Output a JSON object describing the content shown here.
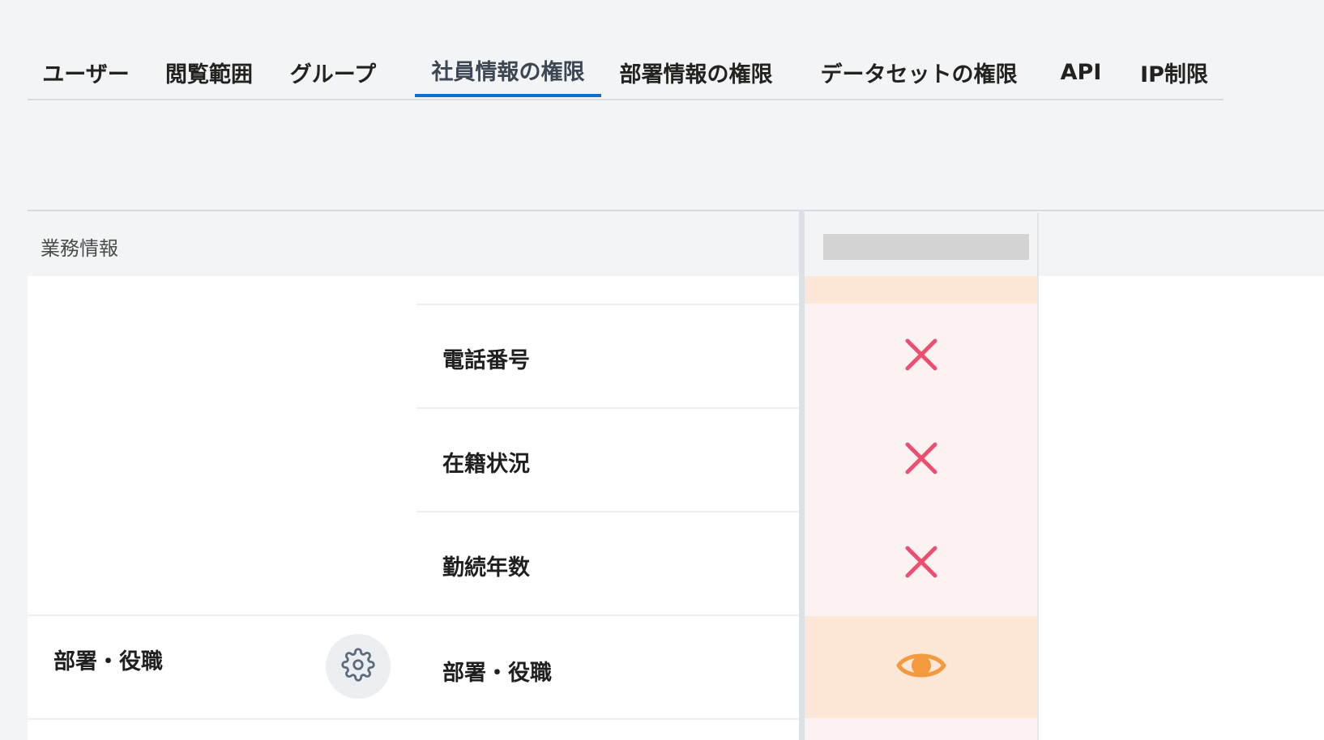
{
  "tabs": [
    {
      "label": "ユーザー",
      "active": false
    },
    {
      "label": "閲覧範囲",
      "active": false
    },
    {
      "label": "グループ",
      "active": false
    },
    {
      "label": "社員情報の権限",
      "active": true
    },
    {
      "label": "部署情報の権限",
      "active": false
    },
    {
      "label": "データセットの権限",
      "active": false
    },
    {
      "label": "API",
      "active": false
    },
    {
      "label": "IP制限",
      "active": false
    }
  ],
  "section": {
    "title": "業務情報"
  },
  "rows": [
    {
      "label": "電話番号",
      "permission": "none"
    },
    {
      "label": "在籍状況",
      "permission": "none"
    },
    {
      "label": "勤続年数",
      "permission": "none"
    },
    {
      "group_label": "部署・役職",
      "label": "部署・役職",
      "permission": "view"
    }
  ],
  "colors": {
    "accent": "#0f6fcf",
    "deny": "#ee4d72",
    "view": "#f39a3e",
    "view_bg": "#fde8d7",
    "deny_bg": "#fdf2f2"
  },
  "icons": {
    "deny": "close-icon",
    "view": "eye-icon",
    "settings": "gear-icon"
  }
}
